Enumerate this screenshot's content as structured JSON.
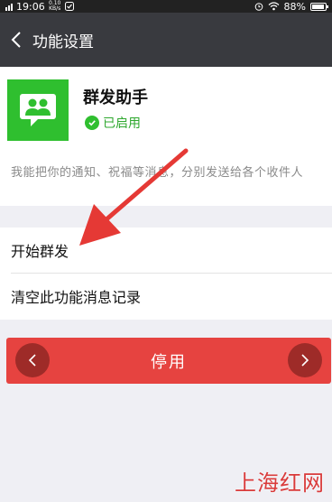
{
  "status_bar": {
    "time": "19:06",
    "net_speed_top": "0.10",
    "net_speed_bottom": "KB/s",
    "battery": "88%"
  },
  "header": {
    "title": "功能设置"
  },
  "plugin": {
    "name": "群发助手",
    "status": "已启用",
    "description": "我能把你的通知、祝福等消息，分别发送给各个收件人"
  },
  "menu": {
    "items": [
      {
        "label": "开始群发"
      },
      {
        "label": "清空此功能消息记录"
      }
    ]
  },
  "action": {
    "disable_label": "停用"
  },
  "watermark": {
    "text": "上海红网"
  },
  "colors": {
    "title_bar": "#393a3f",
    "accent_green": "#2fbf2f",
    "danger_red": "#e64340",
    "arrow_red": "#e53935"
  }
}
